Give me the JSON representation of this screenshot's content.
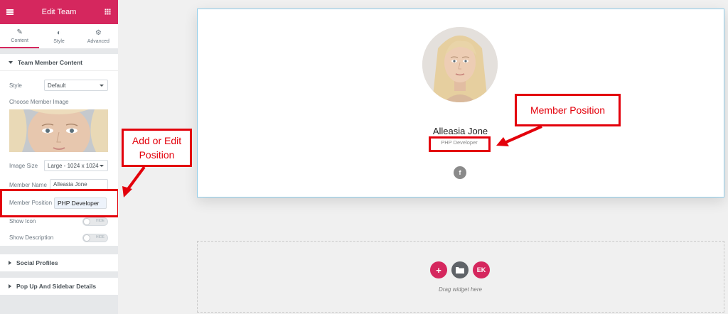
{
  "panel": {
    "title": "Edit Team",
    "tabs": [
      {
        "label": "Content",
        "icon": "pencil-icon"
      },
      {
        "label": "Style",
        "icon": "contrast-icon"
      },
      {
        "label": "Advanced",
        "icon": "gear-icon"
      }
    ],
    "section_title": "Team Member Content",
    "style_label": "Style",
    "style_value": "Default",
    "image_label": "Choose Member Image",
    "image_size_label": "Image Size",
    "image_size_value": "Large - 1024 x 1024",
    "member_name_label": "Member Name",
    "member_name_value": "Alleasia Jone",
    "member_position_label": "Member Position",
    "member_position_value": "PHP Developer",
    "show_icon_label": "Show Icon",
    "show_description_label": "Show Description",
    "toggle_text": "HIDE",
    "social_profiles": "Social Profiles",
    "popup_details": "Pop Up And Sidebar Details"
  },
  "card": {
    "name": "Alleasia Jone",
    "position": "PHP Developer",
    "facebook_glyph": "f"
  },
  "dropzone": {
    "hint": "Drag widget here",
    "buttons": [
      {
        "glyph": "+",
        "color": "#d5275e"
      },
      {
        "icon": "folder-icon",
        "color": "#5f6368"
      },
      {
        "glyph": "EK",
        "color": "#d5275e"
      }
    ]
  },
  "annotations": {
    "left_callout": "Add or Edit Position",
    "right_callout": "Member Position",
    "color": "#e3000b"
  },
  "colors": {
    "accent": "#d5275e",
    "panel_bg": "#e6e8ea",
    "canvas_bg": "#f0f0f0"
  }
}
